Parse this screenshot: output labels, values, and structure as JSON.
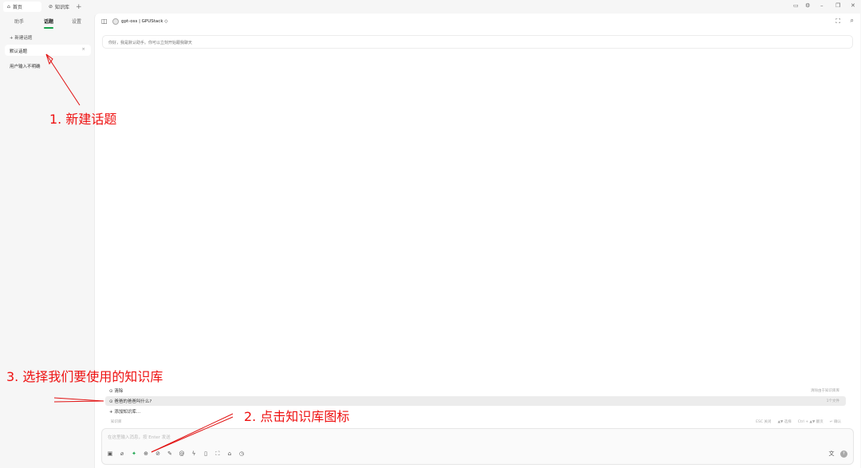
{
  "tabs": [
    {
      "label": "首页",
      "icon": "home-icon"
    },
    {
      "label": "知识库",
      "icon": "knowledge-icon"
    }
  ],
  "window_controls": [
    "monitor-icon",
    "gear-icon",
    "minimize-icon",
    "restore-icon",
    "close-icon"
  ],
  "sidebar": {
    "tabs": [
      "助手",
      "话题",
      "设置"
    ],
    "active_tab": "话题",
    "new_topic_label": "+ 新建话题",
    "topics": [
      "默认话题",
      "用户输入不明确"
    ],
    "active_topic": "默认话题"
  },
  "navbar": {
    "model": "gpt-oss | GPUStack ◇"
  },
  "chat": {
    "welcome": "你好，我是默认助手。你可以立刻开始跟我聊天"
  },
  "kb_popup": {
    "items": [
      {
        "label": "⊙ 清除",
        "right": "清除由于知识库库"
      },
      {
        "label": "⊙ 爸爸的爸爸叫什么?",
        "right": "1个文件"
      },
      {
        "label": "+ 添加知识库...",
        "right": ""
      }
    ],
    "selected_index": 1,
    "footer_left": "知识库",
    "footer_hints": [
      "ESC 关闭",
      "▲▼ 选择",
      "Ctrl + ▲▼ 翻页",
      "↵ 确认"
    ]
  },
  "input": {
    "placeholder": "在这里输入消息，按 Enter 发送"
  },
  "toolbar_icons": [
    "new-chat-icon",
    "attach-icon",
    "sparkle-icon",
    "globe-icon",
    "knowledge-base-icon",
    "paint-icon",
    "mention-icon",
    "flash-icon",
    "clip-icon",
    "expand-icon",
    "eraser-icon",
    "clock-icon"
  ],
  "annotations": {
    "step1": "1. 新建话题",
    "step2": "2. 点击知识库图标",
    "step3": "3. 选择我们要使用的知识库"
  },
  "colors": {
    "accent": "#16a34a",
    "annotation": "#e11111"
  }
}
